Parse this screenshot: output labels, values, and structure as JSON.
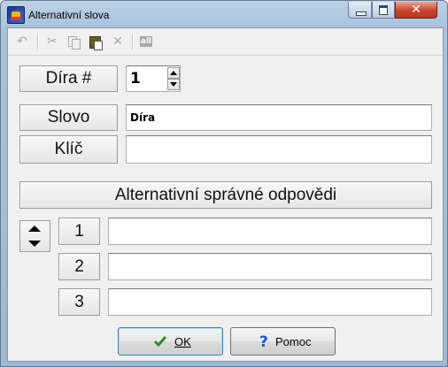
{
  "window": {
    "title": "Alternativní slova",
    "close_glyph": "✕"
  },
  "toolbar": {
    "undo_icon": "↶",
    "cut_icon": "✂",
    "delete_icon": "✕",
    "select_all_label": "all"
  },
  "form": {
    "hole_label": "Díra #",
    "hole_value": "1",
    "word_label": "Slovo",
    "word_value": "Díra",
    "key_label": "Klíč",
    "key_value": "",
    "alt_header": "Alternativní správné odpovědi",
    "rows": [
      {
        "number": "1",
        "value": ""
      },
      {
        "number": "2",
        "value": ""
      },
      {
        "number": "3",
        "value": ""
      }
    ]
  },
  "buttons": {
    "ok_label": "OK",
    "help_label": "Pomoc"
  },
  "colors": {
    "check": "#2e8b2e",
    "question": "#1f55c7"
  }
}
